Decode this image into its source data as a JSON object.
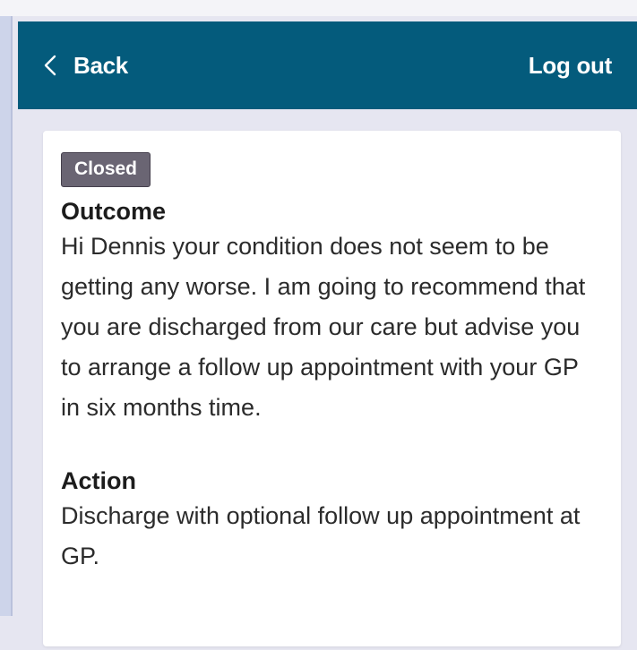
{
  "header": {
    "back_label": "Back",
    "logout_label": "Log out",
    "background_color": "#045b7c",
    "back_icon": "chevron-left-icon"
  },
  "card": {
    "status_badge": "Closed",
    "outcome": {
      "heading": "Outcome",
      "body": "Hi Dennis your condition does not seem to be getting any worse. I am going to recommend that you are discharged from our care but advise you to arrange a follow up appointment with your GP in six months time."
    },
    "action": {
      "heading": "Action",
      "body": "Discharge with optional follow up appointment at GP."
    }
  }
}
